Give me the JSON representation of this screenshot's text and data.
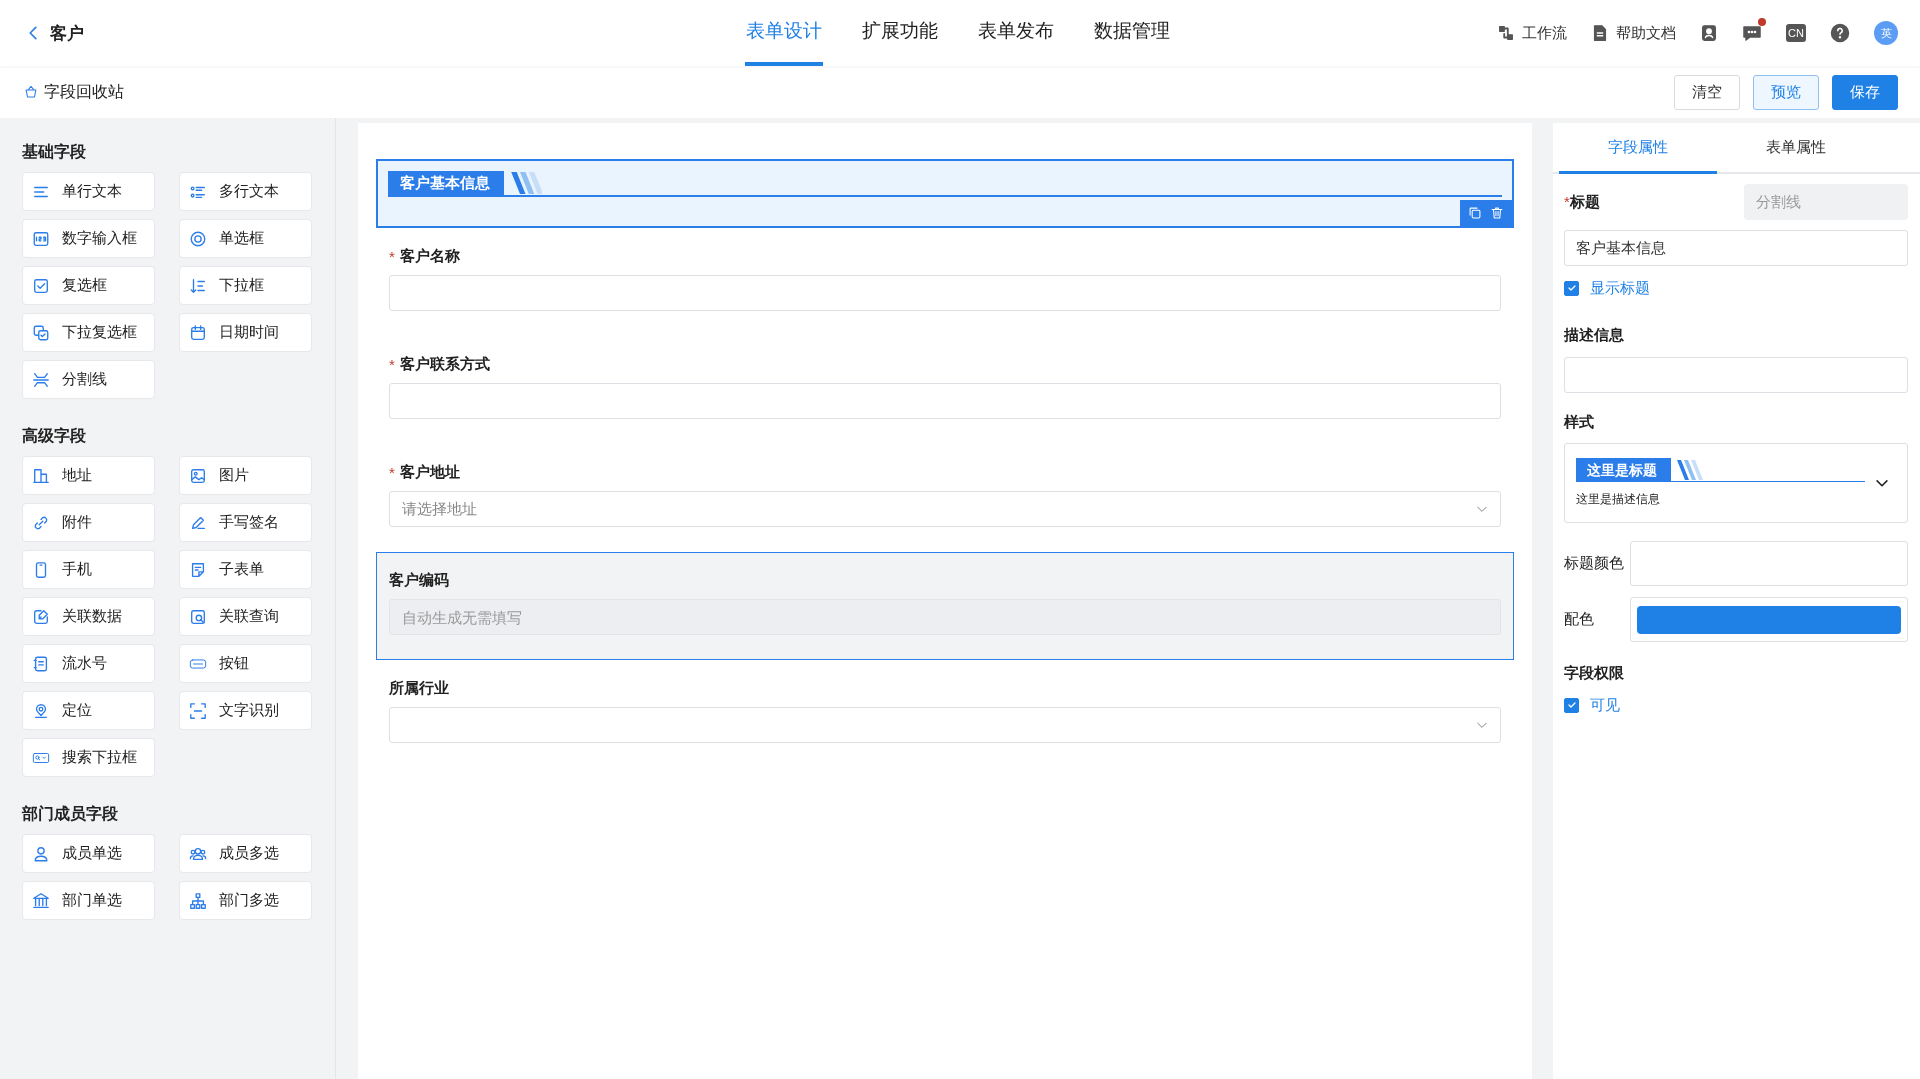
{
  "header": {
    "back_label": "客户",
    "nav": [
      {
        "label": "表单设计",
        "selected": true
      },
      {
        "label": "扩展功能",
        "selected": false
      },
      {
        "label": "表单发布",
        "selected": false
      },
      {
        "label": "数据管理",
        "selected": false
      }
    ],
    "tools": [
      {
        "label": "工作流"
      },
      {
        "label": "帮助文档"
      }
    ],
    "messages_unread": true,
    "language": "CN",
    "avatar": "英"
  },
  "toolbar": {
    "recycle_bin": "字段回收站",
    "buttons": [
      {
        "label": "清空",
        "kind": "default"
      },
      {
        "label": "预览",
        "kind": "light"
      },
      {
        "label": "保存",
        "kind": "primary"
      }
    ]
  },
  "palette": {
    "sections": [
      {
        "title": "基础字段",
        "items": [
          "单行文本",
          "多行文本",
          "数字输入框",
          "单选框",
          "复选框",
          "下拉框",
          "下拉复选框",
          "日期时间",
          "分割线"
        ]
      },
      {
        "title": "高级字段",
        "items": [
          "地址",
          "图片",
          "附件",
          "手写签名",
          "手机",
          "子表单",
          "关联数据",
          "关联查询",
          "流水号",
          "按钮",
          "定位",
          "文字识别",
          "搜索下拉框"
        ]
      },
      {
        "title": "部门成员字段",
        "items": [
          "成员单选",
          "成员多选",
          "部门单选",
          "部门多选"
        ]
      }
    ]
  },
  "form": {
    "section_header": {
      "title": "客户基本信息",
      "selected": true
    },
    "fields": [
      {
        "label": "客户名称",
        "required_mark": "*",
        "kind": "input",
        "disabled": false,
        "hovered": false
      },
      {
        "label": "客户联系方式",
        "required_mark": "*",
        "kind": "input",
        "disabled": false,
        "hovered": false
      },
      {
        "label": "客户地址",
        "required_mark": "*",
        "kind": "select",
        "placeholder": "请选择地址",
        "disabled": false,
        "hovered": false
      },
      {
        "label": "客户编码",
        "kind": "input",
        "placeholder": "自动生成无需填写",
        "disabled": true,
        "hovered": true
      },
      {
        "label": "所属行业",
        "kind": "select",
        "disabled": false,
        "hovered": false
      }
    ]
  },
  "properties": {
    "tabs": [
      {
        "label": "字段属性",
        "selected": true
      },
      {
        "label": "表单属性",
        "selected": false
      }
    ],
    "title_label": "标题",
    "title_required_mark": "*",
    "field_type": "分割线",
    "title_value": "客户基本信息",
    "show_title": {
      "label": "显示标题",
      "checked": true
    },
    "description_label": "描述信息",
    "style_label": "样式",
    "style_preview": {
      "title": "这里是标题",
      "description": "这里是描述信息"
    },
    "title_color_label": "标题颜色",
    "scheme_label": "配色",
    "permission_label": "字段权限",
    "visible": {
      "label": "可见",
      "checked": true
    }
  }
}
